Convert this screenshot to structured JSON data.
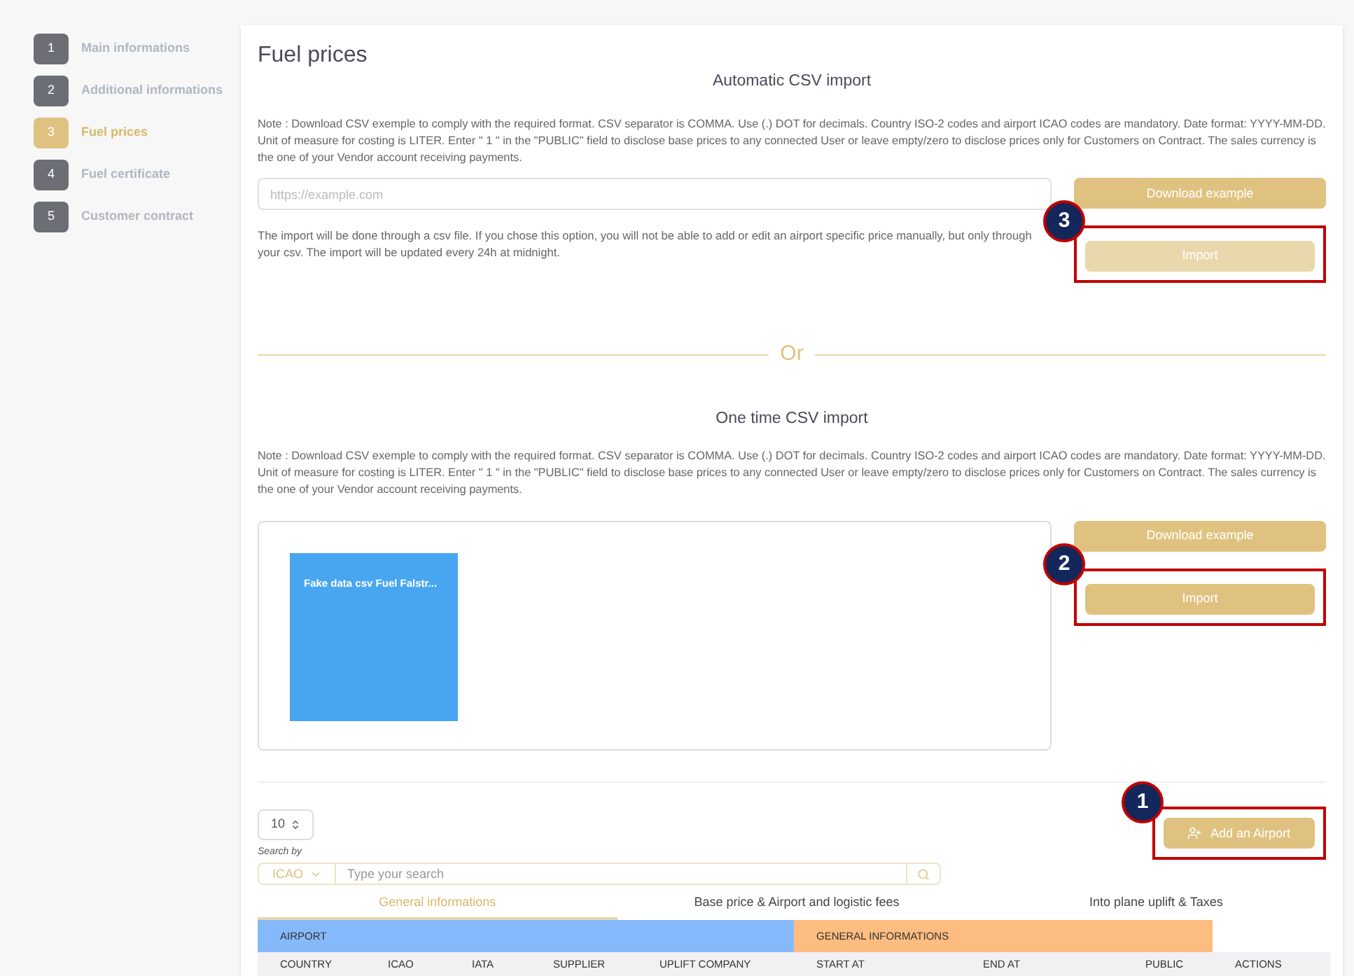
{
  "steps": [
    {
      "number": "1",
      "label": "Main informations",
      "selected": false
    },
    {
      "number": "2",
      "label": "Additional informations",
      "selected": false
    },
    {
      "number": "3",
      "label": "Fuel prices",
      "selected": true
    },
    {
      "number": "4",
      "label": "Fuel certificate",
      "selected": false
    },
    {
      "number": "5",
      "label": "Customer contract",
      "selected": false
    }
  ],
  "page_title": "Fuel prices",
  "automatic_import": {
    "title": "Automatic CSV import",
    "note": "Note : Download CSV exemple to comply with the required format. CSV separator is COMMA. Use (.) DOT for decimals. Country ISO-2 codes and airport ICAO codes are mandatory. Date format: YYYY-MM-DD. Unit of measure for costing is LITER. Enter \" 1 \" in the \"PUBLIC\" field to disclose base prices to any connected User or leave empty/zero to disclose prices only for Customers on Contract. The sales currency is the one of your Vendor account receiving payments.",
    "url_placeholder": "https://example.com",
    "info": "The import will be done through a csv file. If you chose this option, you will not be able to add or edit an airport specific price manually, but only through your csv. The import will be updated every 24h at midnight.",
    "buttons": [
      {
        "label": "Download example",
        "disabled": false
      },
      {
        "label": "Import",
        "disabled": true,
        "callout": "3"
      }
    ]
  },
  "separator": "Or",
  "one_time_import": {
    "title": "One time CSV import",
    "note": "Note : Download CSV exemple to comply with the required format. CSV separator is COMMA. Use (.) DOT for decimals. Country ISO-2 codes and airport ICAO codes are mandatory. Date format: YYYY-MM-DD. Unit of measure for costing is LITER. Enter \" 1 \" in the \"PUBLIC\" field to disclose base prices to any connected User or leave empty/zero to disclose prices only for Customers on Contract. The sales currency is the one of your Vendor account receiving payments.",
    "file_name": "Fake data csv Fuel Falstr...",
    "buttons": [
      {
        "label": "Download example",
        "disabled": false
      },
      {
        "label": "Import",
        "disabled": false,
        "callout": "2"
      }
    ]
  },
  "page_size": "10",
  "search_by_label": "Search by",
  "search_field": {
    "value": "ICAO",
    "placeholder": "Type your search"
  },
  "add_button": {
    "label": "Add an Airport",
    "callout": "1"
  },
  "tabs": [
    {
      "label": "General informations",
      "selected": true
    },
    {
      "label": "Base price & Airport and logistic fees",
      "selected": false
    },
    {
      "label": "Into plane uplift & Taxes",
      "selected": false
    }
  ],
  "table": {
    "groups": [
      {
        "label": "AIRPORT",
        "color": "#86b9fb"
      },
      {
        "label": "GENERAL INFORMATIONS",
        "color": "#fdbd80"
      }
    ],
    "columns": [
      "COUNTRY",
      "ICAO",
      "IATA",
      "SUPPLIER",
      "UPLIFT COMPANY",
      "START AT",
      "END AT",
      "PUBLIC",
      "ACTIONS"
    ]
  }
}
